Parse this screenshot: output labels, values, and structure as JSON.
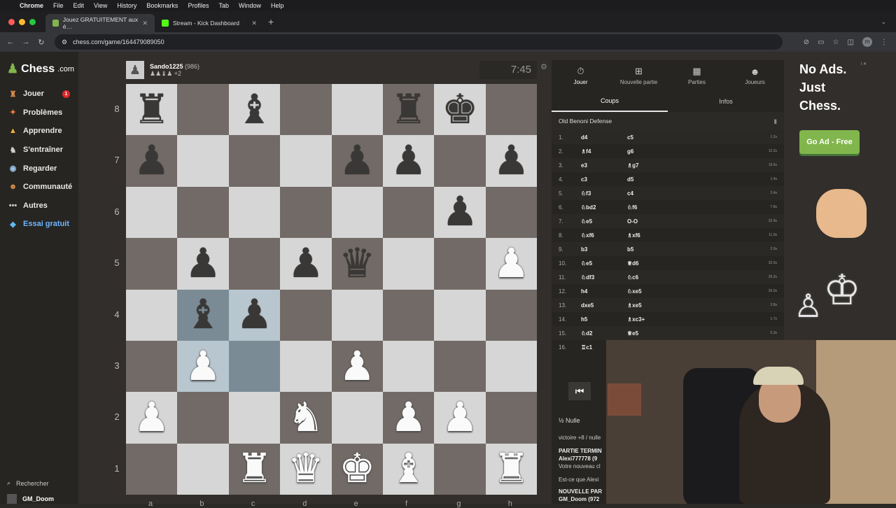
{
  "menubar": {
    "app": "Chrome",
    "items": [
      "File",
      "Edit",
      "View",
      "History",
      "Bookmarks",
      "Profiles",
      "Tab",
      "Window",
      "Help"
    ]
  },
  "tabs": [
    {
      "title": "Jouez GRATUITEMENT aux é…",
      "active": true,
      "favicon_color": "#81b64c"
    },
    {
      "title": "Stream - Kick Dashboard",
      "active": false,
      "favicon_color": "#53fc18"
    }
  ],
  "address": {
    "url": "chess.com/game/164479089050"
  },
  "sidebar": {
    "logo": "Chess",
    "logo_suffix": ".com",
    "items": [
      {
        "label": "Jouer",
        "icon": "play-icon",
        "badge": "1"
      },
      {
        "label": "Problèmes",
        "icon": "puzzle-icon"
      },
      {
        "label": "Apprendre",
        "icon": "learn-icon"
      },
      {
        "label": "S'entraîner",
        "icon": "train-icon"
      },
      {
        "label": "Regarder",
        "icon": "watch-icon"
      },
      {
        "label": "Communauté",
        "icon": "community-icon"
      },
      {
        "label": "Autres",
        "icon": "more-icon"
      },
      {
        "label": "Essai gratuit",
        "icon": "diamond-icon"
      }
    ],
    "search": "Rechercher",
    "user": "GM_Doom"
  },
  "opponent": {
    "name": "Sando1225",
    "rating": "(986)",
    "captured": "♟♟♝♟ +2",
    "clock": "7:45"
  },
  "board": {
    "ranks": [
      "8",
      "7",
      "6",
      "5",
      "4",
      "3",
      "2",
      "1"
    ],
    "files": [
      "a",
      "b",
      "c",
      "d",
      "e",
      "f",
      "g",
      "h"
    ],
    "rows": [
      [
        "r",
        "",
        "b",
        "",
        "",
        "r",
        "k",
        ""
      ],
      [
        "p",
        "",
        "",
        "",
        "p",
        "p",
        "",
        "p"
      ],
      [
        "",
        "",
        "",
        "",
        "",
        "",
        "p",
        ""
      ],
      [
        "",
        "p",
        "",
        "p",
        "q",
        "",
        "",
        "P"
      ],
      [
        "",
        "b",
        "p",
        "",
        "",
        "",
        "",
        ""
      ],
      [
        "",
        "P",
        "",
        "",
        "P",
        "",
        "",
        ""
      ],
      [
        "P",
        "",
        "",
        "N",
        "",
        "P",
        "P",
        ""
      ],
      [
        "",
        "",
        "R",
        "Q",
        "K",
        "B",
        "",
        "R"
      ]
    ],
    "highlight": [
      "b4",
      "c3",
      "b3",
      "c4"
    ]
  },
  "panel": {
    "tabs": [
      {
        "label": "Jouer",
        "icon": "clock-icon",
        "active": true
      },
      {
        "label": "Nouvelle partie",
        "icon": "plus-icon"
      },
      {
        "label": "Parties",
        "icon": "grid-icon"
      },
      {
        "label": "Joueurs",
        "icon": "players-icon"
      }
    ],
    "subtabs": [
      "Coups",
      "Infos"
    ],
    "opening": "Old Benoni Defense",
    "moves": [
      {
        "n": "1.",
        "w": "d4",
        "b": "c5",
        "t": "1.2s"
      },
      {
        "n": "2.",
        "w": "♗f4",
        "b": "g6",
        "t": "12.2s"
      },
      {
        "n": "3.",
        "w": "e3",
        "b": "♗g7",
        "t": "19.5s"
      },
      {
        "n": "4.",
        "w": "c3",
        "b": "d5",
        "t": "1.4s"
      },
      {
        "n": "5.",
        "w": "♘f3",
        "b": "c4",
        "t": "2.4s"
      },
      {
        "n": "6.",
        "w": "♘bd2",
        "b": "♘f6",
        "t": "7.8s"
      },
      {
        "n": "7.",
        "w": "♘e5",
        "b": "O-O",
        "t": "32.9s"
      },
      {
        "n": "8.",
        "w": "♘xf6",
        "b": "♗xf6",
        "t": "11.9s"
      },
      {
        "n": "9.",
        "w": "b3",
        "b": "b5",
        "t": "2.0s"
      },
      {
        "n": "10.",
        "w": "♘e5",
        "b": "♕d6",
        "t": "32.5s"
      },
      {
        "n": "11.",
        "w": "♘df3",
        "b": "♘c6",
        "t": "25.2s"
      },
      {
        "n": "12.",
        "w": "h4",
        "b": "♘xe5",
        "t": "26.0s"
      },
      {
        "n": "13.",
        "w": "dxe5",
        "b": "♗xe5",
        "t": "3.8s"
      },
      {
        "n": "14.",
        "w": "h5",
        "b": "♗xc3+",
        "t": "1.7s"
      },
      {
        "n": "15.",
        "w": "♘d2",
        "b": "♕e5",
        "t": "5.3s"
      },
      {
        "n": "16.",
        "w": "♖c1",
        "b": "",
        "t": ""
      }
    ],
    "draw": "Nulle",
    "chat": [
      "victoire +8 / nulle",
      "PARTIE TERMIN",
      "Alexi777778 (9",
      "Votre nouveau cl",
      "Est-ce que Alexi",
      "NOUVELLE PAR",
      "GM_Doom (972"
    ]
  },
  "ad": {
    "headline": [
      "No Ads.",
      "Just",
      "Chess."
    ],
    "button": "Go Ad - Free",
    "info": "i ✕"
  }
}
